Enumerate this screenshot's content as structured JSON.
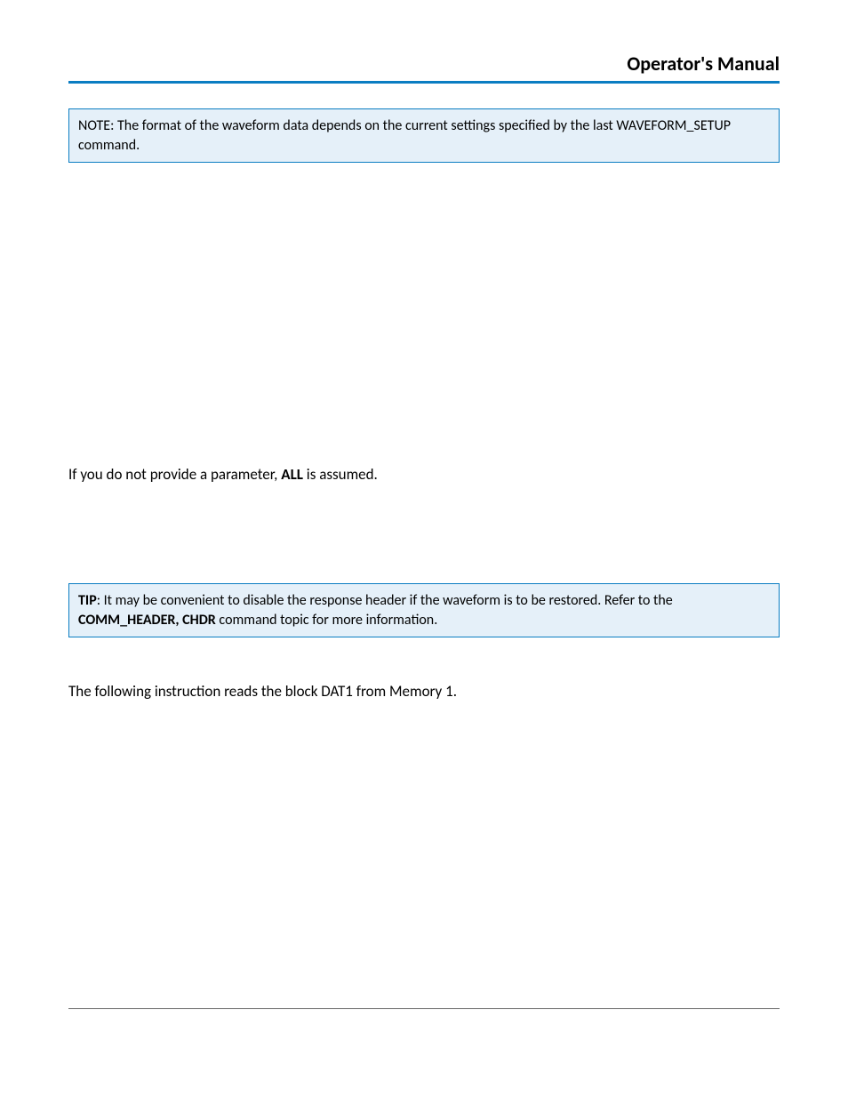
{
  "header": {
    "title": "Operator's Manual"
  },
  "note": {
    "text": "NOTE: The format of the waveform data depends on the current settings specified by the last WAVEFORM_SETUP command."
  },
  "paragraph1": {
    "prefix": "If you do not provide a parameter, ",
    "bold": "ALL",
    "suffix": " is assumed."
  },
  "tip": {
    "boldLabel": "TIP",
    "text1": ": It may be convenient to disable the response header if the waveform is to be restored. Refer to the ",
    "bold2": "COMM_HEADER, CHDR",
    "text2": " command topic for more information."
  },
  "example": {
    "text": "The following instruction reads the block DAT1 from Memory 1."
  }
}
